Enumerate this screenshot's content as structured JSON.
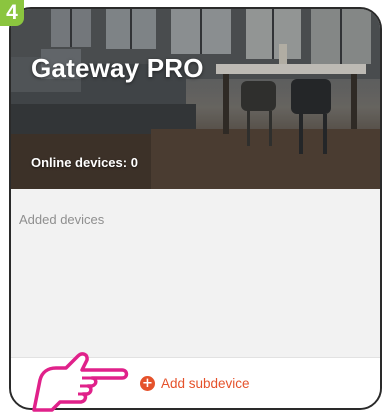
{
  "step_badge": "4",
  "header": {
    "title": "Gateway PRO",
    "online_status": "Online devices: 0"
  },
  "devices": {
    "section_label": "Added devices"
  },
  "actions": {
    "add_subdevice_label": "Add subdevice",
    "add_icon_glyph": "+"
  },
  "colors": {
    "accent": "#e5522b",
    "badge": "#8bc53f",
    "pointer_hand": "#e0218a"
  },
  "icons": {
    "add": "plus-circle-icon",
    "pointer": "pointing-hand-icon"
  }
}
